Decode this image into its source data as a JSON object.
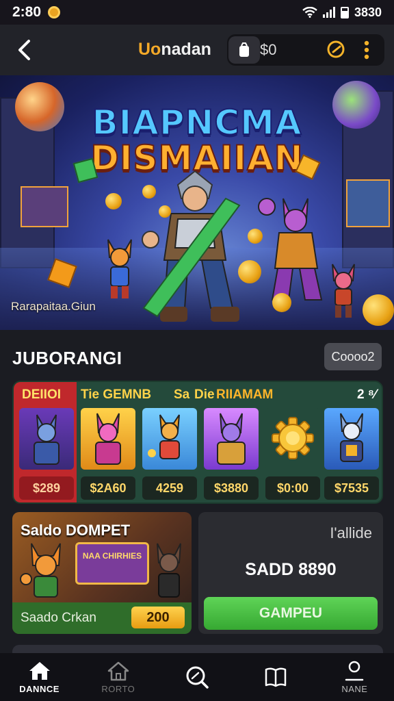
{
  "status_bar": {
    "time": "2:80",
    "battery_text": "3830"
  },
  "header": {
    "title_prefix": "Uo",
    "title_rest": "nadan",
    "balance": "$0"
  },
  "banner": {
    "title_line1": "BIAPNCMA",
    "title_line2": "DISMAIIAN",
    "url": "Rarapaitaa.Giun"
  },
  "section": {
    "title": "JUBORANGI",
    "badge": "Coooo2"
  },
  "games_strip": {
    "labels": [
      "DEIIOI",
      "Tie GEMNB",
      "Sa",
      "Die",
      "RIIAMAM",
      "2 ⁸⁄"
    ],
    "games": [
      {
        "price": "$289"
      },
      {
        "price": "$2A60"
      },
      {
        "price": "4259"
      },
      {
        "price": "$3880"
      },
      {
        "price": "$0:00"
      },
      {
        "price": "$7535"
      }
    ]
  },
  "wallet_card": {
    "title": "Saldo DOMPET",
    "box_text": "NAA CHIRHIES",
    "footer_label": "Saado Crkan",
    "amount": "200"
  },
  "balance_card": {
    "label": "I'allide",
    "amount": "SADD 8890",
    "button": "GAMPEU"
  },
  "bottom_nav": [
    {
      "label": "DANNCE",
      "icon": "home-icon"
    },
    {
      "label": "RORTO",
      "icon": "home-outline-icon"
    },
    {
      "label": "",
      "icon": "search-icon"
    },
    {
      "label": "",
      "icon": "book-icon"
    },
    {
      "label": "NANE",
      "icon": "profile-icon"
    }
  ],
  "colors": {
    "accent": "#f4a928",
    "button_green": "#4cc144",
    "strip_bg": "#244a3b",
    "first_tile_red": "#c0282c"
  }
}
